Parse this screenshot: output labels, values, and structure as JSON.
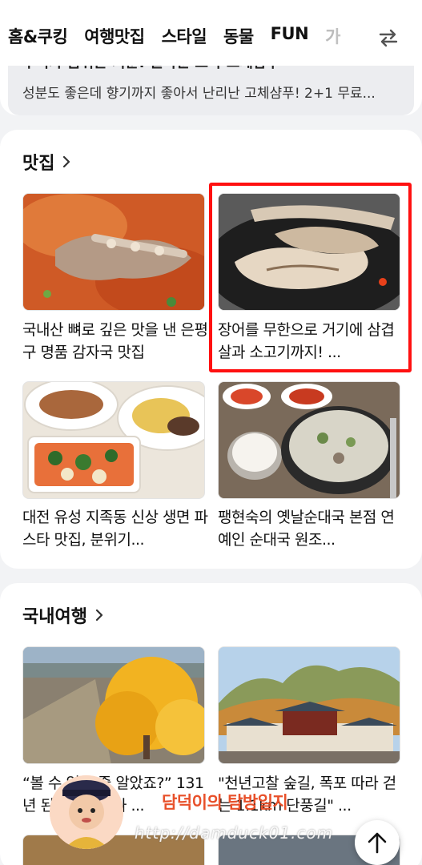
{
  "topbar": {
    "tabs": [
      "홈&쿠킹",
      "여행맛집",
      "스타일",
      "동물",
      "FUN"
    ],
    "tab_cut": "가"
  },
  "teaser": {
    "title": "두피가 숨쉬는 기분! 놀라운 스타 고체샴푸",
    "subtitle": "성분도 좋은데 향기까지 좋아서 난리난 고체샴푸! 2+1 무료..."
  },
  "sections": [
    {
      "title": "맛집",
      "items": [
        {
          "caption": "국내산 뼈로 깊은 맛을 낸 은평구 명품 감자국 맛집"
        },
        {
          "caption": "장어를 무한으로 거기에 삼겹살과 소고기까지! ..."
        },
        {
          "caption": "대전 유성 지족동 신상 생면 파스타 맛집, 분위기..."
        },
        {
          "caption": "팽현숙의 옛날순대국 본점 연예인 순대국 원조..."
        }
      ]
    },
    {
      "title": "국내여행",
      "items": [
        {
          "caption": "“볼 수 있을 줄 알았죠?” 131년 된 은행나무가 ..."
        },
        {
          "caption": "\"천년고찰 숲길, 폭포 따라 걷는 1.1km 단풍길\" ..."
        }
      ]
    }
  ],
  "watermark": {
    "name": "담덕이의 탐방일지",
    "url": "http://damduck01.com"
  },
  "colors": {
    "highlight": "#ff1010",
    "watermark_name": "#e8502a"
  }
}
